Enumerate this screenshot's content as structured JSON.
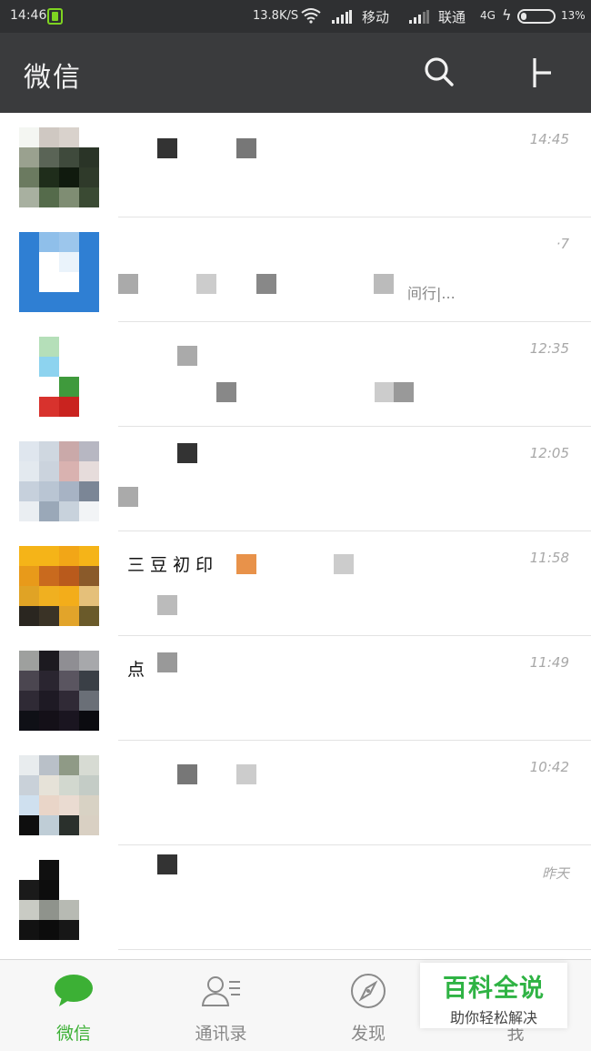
{
  "status_bar": {
    "time": "14:46",
    "net_speed": "13.8K/S",
    "carrier_1": "移动",
    "carrier_2": "联通",
    "network_type": "4G",
    "battery_percent": "13%",
    "battery_level": 0.13,
    "icons": [
      "notification-icon",
      "wifi-icon",
      "signal-icon",
      "charging-icon",
      "battery-icon"
    ]
  },
  "app_bar": {
    "title": "微信",
    "actions": [
      "search-icon",
      "add-icon"
    ]
  },
  "chats": [
    {
      "name": "",
      "preview": "",
      "time": "14:45",
      "avatar_colors": [
        "#f4f6f2",
        "#cfc8c2",
        "#d9d2cc",
        "#ffffff",
        "#9aa18f",
        "#5a6456",
        "#3f4a3c",
        "#2a3427",
        "#6b7a60",
        "#1f2d1b",
        "#101a0e",
        "#2f3a2a",
        "#a8b0a0",
        "#556b4b",
        "#7f8d73",
        "#3a4a33"
      ]
    },
    {
      "name": "",
      "preview": "间行|...",
      "time": "·7",
      "avatar_colors": [
        "#2f7fd3",
        "#8fbfea",
        "#9cc6ec",
        "#2f7fd3",
        "#2f7fd3",
        "#ffffff",
        "#eaf3fb",
        "#2f7fd3",
        "#2f7fd3",
        "#ffffff",
        "#ffffff",
        "#2f7fd3",
        "#2f7fd3",
        "#2f7fd3",
        "#2f7fd3",
        "#2f7fd3"
      ]
    },
    {
      "name": "",
      "preview": "",
      "time": "12:35",
      "avatar_colors": [
        "#ffffff",
        "#b5dfb9",
        "#ffffff",
        "#ffffff",
        "#ffffff",
        "#8dd3ef",
        "#ffffff",
        "#ffffff",
        "#ffffff",
        "#ffffff",
        "#3f9a3c",
        "#ffffff",
        "#ffffff",
        "#d8322d",
        "#c9231f",
        "#ffffff"
      ]
    },
    {
      "name": "",
      "preview": "",
      "time": "12:05",
      "avatar_colors": [
        "#dfe6ee",
        "#cfd7e0",
        "#caa9a9",
        "#b7b7c2",
        "#e3e9ef",
        "#cbd3dd",
        "#d9b2b0",
        "#e6dcdb",
        "#c6d0dc",
        "#b9c5d3",
        "#a7b3c4",
        "#7b8696",
        "#eaeef2",
        "#9aa8b8",
        "#c8d2dc",
        "#f2f4f6"
      ]
    },
    {
      "name": "三 豆 初 印",
      "preview": "",
      "time": "11:58",
      "avatar_colors": [
        "#f5b418",
        "#f5b418",
        "#f2a617",
        "#f5b418",
        "#e89a1a",
        "#c96a1e",
        "#b95a1c",
        "#8a5a2a",
        "#e0a325",
        "#f0b020",
        "#f3ad1a",
        "#e5c07a",
        "#2a2620",
        "#3a3326",
        "#e2a42a",
        "#6a5a2a"
      ]
    },
    {
      "name": "点",
      "preview": "",
      "time": "11:49",
      "avatar_colors": [
        "#9ea09e",
        "#1c1a20",
        "#8f8e93",
        "#a7a8ab",
        "#4b4650",
        "#2a2530",
        "#5a5560",
        "#3a3f46",
        "#2f2a35",
        "#1e1a24",
        "#302a36",
        "#6a6f77",
        "#0f1016",
        "#141018",
        "#1a1520",
        "#0b0b10"
      ]
    },
    {
      "name": "",
      "preview": "",
      "time": "10:42",
      "avatar_colors": [
        "#e8ecee",
        "#b9c0c8",
        "#8f9a86",
        "#d7dbd3",
        "#c9d1d9",
        "#e6e2d8",
        "#d2d8cf",
        "#c4ccc6",
        "#cfe0ef",
        "#e9d5c8",
        "#eadbd1",
        "#d8d2c4",
        "#0e0e0e",
        "#bfcdd6",
        "#2a302c",
        "#d9d0c3"
      ]
    },
    {
      "name": "",
      "preview": "",
      "time": "昨天",
      "avatar_colors": [
        "#ffffff",
        "#101010",
        "#ffffff",
        "#ffffff",
        "#1a1a1a",
        "#0d0d0d",
        "#ffffff",
        "#ffffff",
        "#c9cbc4",
        "#8f938c",
        "#b7bab3",
        "#ffffff",
        "#121212",
        "#0c0c0c",
        "#171717",
        "#ffffff"
      ]
    }
  ],
  "bottom_nav": {
    "items": [
      {
        "label": "微信",
        "icon": "chat-bubble-icon",
        "active": true
      },
      {
        "label": "通讯录",
        "icon": "contacts-icon",
        "active": false
      },
      {
        "label": "发现",
        "icon": "compass-icon",
        "active": false
      },
      {
        "label": "我",
        "icon": "profile-icon",
        "active": false
      }
    ]
  },
  "watermark": {
    "main": "百科全说",
    "sub": "助你轻松解决"
  },
  "colors": {
    "status_bar_bg": "#2f3032",
    "app_bar_bg": "#3a3b3d",
    "accent_green": "#3cb035",
    "watermark_green": "#2fb344"
  }
}
